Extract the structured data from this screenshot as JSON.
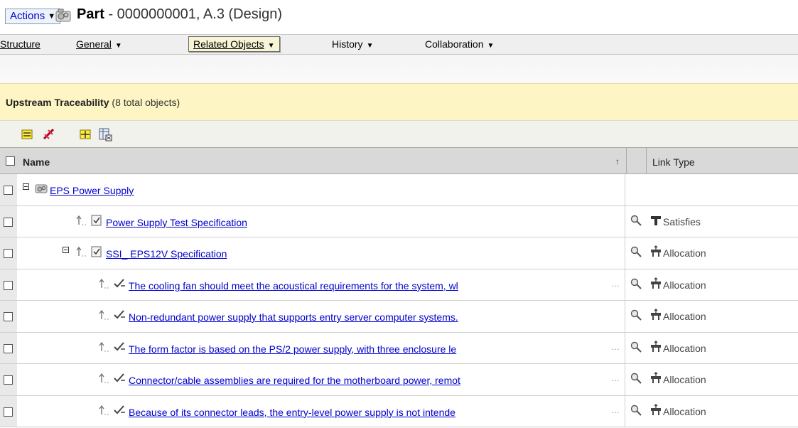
{
  "header": {
    "actions_label": "Actions",
    "title_bold": "Part",
    "title_rest": " - 0000000001, A.3 (Design)"
  },
  "nav": [
    {
      "label": "Structure"
    },
    {
      "label": "General"
    },
    {
      "label": "Related Objects",
      "active": true
    },
    {
      "label": "History"
    },
    {
      "label": "Collaboration"
    }
  ],
  "trace": {
    "title": "Upstream Traceability",
    "count": "(8 total objects)"
  },
  "table": {
    "col_name": "Name",
    "col_sort": "↑",
    "col_link": "Link Type",
    "rows": [
      {
        "name": "EPS Power Supply",
        "link_type": "",
        "kind": "part"
      },
      {
        "name": "Power Supply Test Specification",
        "link_type": "Satisfies",
        "kind": "spec"
      },
      {
        "name": "SSI_ EPS12V Specification",
        "link_type": "Allocation",
        "kind": "spec"
      },
      {
        "name": "The cooling fan should meet the acoustical requirements for the system, wl",
        "link_type": "Allocation",
        "kind": "req"
      },
      {
        "name": "Non-redundant power supply that supports entry server computer systems.",
        "link_type": "Allocation",
        "kind": "req"
      },
      {
        "name": "The form factor is based on the PS/2 power supply, with three enclosure le",
        "link_type": "Allocation",
        "kind": "req"
      },
      {
        "name": "Connector/cable assemblies are required for the motherboard power, remot",
        "link_type": "Allocation",
        "kind": "req"
      },
      {
        "name": "Because of its connector leads, the entry-level power supply is not intende",
        "link_type": "Allocation",
        "kind": "req"
      }
    ]
  },
  "ellipsis": "…"
}
